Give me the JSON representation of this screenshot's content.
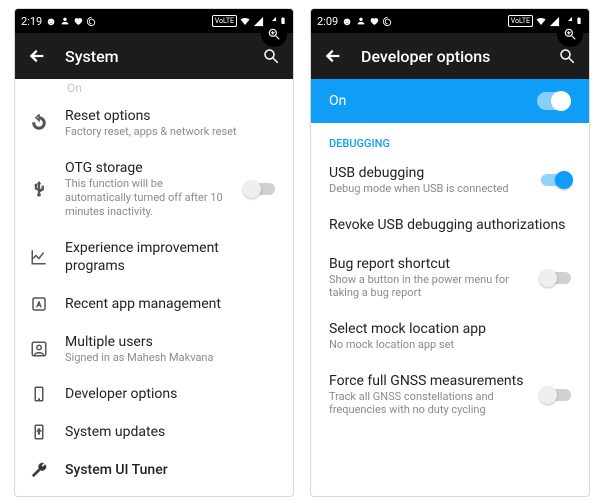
{
  "left": {
    "time": "2:19",
    "header_title": "System",
    "top_cut": "On",
    "items": [
      {
        "title": "Reset options",
        "sub": "Factory reset, apps & network reset"
      },
      {
        "title": "OTG storage",
        "sub": "This function will be automatically turned off after 10 minutes inactivity.",
        "switch": "off"
      },
      {
        "title": "Experience improvement programs",
        "sub": ""
      },
      {
        "title": "Recent app management",
        "sub": ""
      },
      {
        "title": "Multiple users",
        "sub": "Signed in as Mahesh Makvana"
      },
      {
        "title": "Developer options",
        "sub": ""
      },
      {
        "title": "System updates",
        "sub": ""
      },
      {
        "title": "System UI Tuner",
        "sub": ""
      }
    ]
  },
  "right": {
    "time": "2:09",
    "header_title": "Developer options",
    "master_label": "On",
    "section": "DEBUGGING",
    "items": [
      {
        "title": "USB debugging",
        "sub": "Debug mode when USB is connected",
        "switch": "on"
      },
      {
        "title": "Revoke USB debugging authorizations",
        "sub": ""
      },
      {
        "title": "Bug report shortcut",
        "sub": "Show a button in the power menu for taking a bug report",
        "switch": "off"
      },
      {
        "title": "Select mock location app",
        "sub": "No mock location app set"
      },
      {
        "title": "Force full GNSS measurements",
        "sub": "Track all GNSS constellations and frequencies with no duty cycling",
        "switch": "off"
      }
    ]
  }
}
